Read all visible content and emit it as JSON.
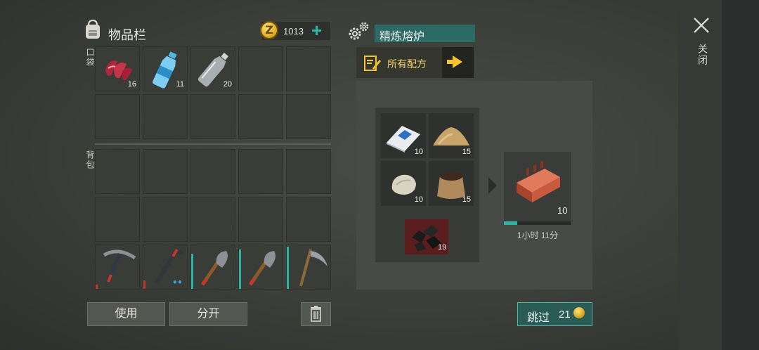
{
  "inventory": {
    "title": "物品栏",
    "coins": "1013",
    "pocket_label": "口袋",
    "backpack_label": "背包",
    "pocket_slots": [
      {
        "item": "raw-meat-icon",
        "count": "16"
      },
      {
        "item": "water-bottle-icon",
        "count": "11"
      },
      {
        "item": "empty-bottle-icon",
        "count": "20"
      },
      {
        "item": "",
        "count": ""
      },
      {
        "item": "",
        "count": ""
      },
      {
        "item": "",
        "count": ""
      },
      {
        "item": "",
        "count": ""
      },
      {
        "item": "",
        "count": ""
      },
      {
        "item": "",
        "count": ""
      },
      {
        "item": "",
        "count": ""
      }
    ],
    "tools": [
      {
        "item": "pickaxe-icon",
        "durability_color": "#c0392b"
      },
      {
        "item": "crowbar-icon",
        "durability_color": "#c0392b"
      },
      {
        "item": "shovel-icon",
        "durability_color": "#2bb3a6"
      },
      {
        "item": "shovel-icon",
        "durability_color": "#2bb3a6"
      },
      {
        "item": "scythe-icon",
        "durability_color": "#2bb3a6"
      }
    ],
    "use_button": "使用",
    "split_button": "分开"
  },
  "crafting": {
    "station_title": "精炼熔炉",
    "all_recipes": "所有配方",
    "ingredients": [
      {
        "item": "cement-bag-icon",
        "count": "10"
      },
      {
        "item": "sand-pile-icon",
        "count": "15"
      },
      {
        "item": "limestone-icon",
        "count": "10"
      },
      {
        "item": "soil-sack-icon",
        "count": "15"
      }
    ],
    "fuel": {
      "item": "coal-icon",
      "count": "19"
    },
    "output": {
      "item": "brick-icon",
      "count": "10"
    },
    "progress_fraction": 0.2,
    "time_remaining": "1小时 11分",
    "skip_label": "跳过",
    "skip_cost": "21"
  },
  "close_label": "关闭",
  "colors": {
    "accent": "#2bb3a6",
    "gold": "#f4c430"
  }
}
